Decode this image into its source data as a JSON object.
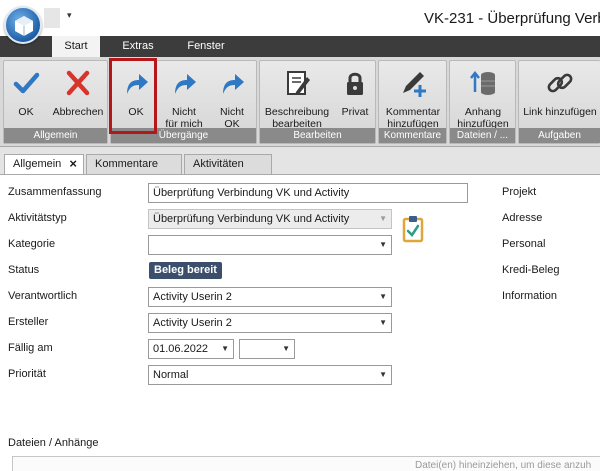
{
  "window": {
    "title": "VK-231 - Überprüfung Verbi"
  },
  "ribbon": {
    "tabs": [
      {
        "label": "Start",
        "active": true
      },
      {
        "label": "Extras",
        "active": false
      },
      {
        "label": "Fenster",
        "active": false
      }
    ],
    "groups": {
      "allgemein": "Allgemein",
      "uebergaenge": "Übergänge",
      "bearbeiten": "Bearbeiten",
      "kommentare": "Kommentare",
      "dateien": "Dateien / ...",
      "aufgaben": "Aufgaben"
    },
    "buttons": {
      "ok": "OK",
      "abbrechen": "Abbrechen",
      "transition_ok": "OK",
      "nicht_fuer_mich_1": "Nicht",
      "nicht_fuer_mich_2": "für mich",
      "nicht_ok_1": "Nicht",
      "nicht_ok_2": "OK",
      "beschreibung_1": "Beschreibung",
      "beschreibung_2": "bearbeiten",
      "privat": "Privat",
      "kommentar_1": "Kommentar",
      "kommentar_2": "hinzufügen",
      "anhang_1": "Anhang",
      "anhang_2": "hinzufügen",
      "link": "Link hinzufügen"
    }
  },
  "doc_tabs": [
    {
      "label": "Allgemein",
      "active": true
    },
    {
      "label": "Kommentare",
      "active": false
    },
    {
      "label": "Aktivitäten",
      "active": false
    }
  ],
  "form": {
    "zusammenfassung": {
      "label": "Zusammenfassung",
      "value": "Überprüfung Verbindung VK und Activity"
    },
    "aktivitaetstyp": {
      "label": "Aktivitätstyp",
      "value": "Überprüfung Verbindung VK und Activity"
    },
    "kategorie": {
      "label": "Kategorie",
      "value": ""
    },
    "status": {
      "label": "Status",
      "value": "Beleg bereit"
    },
    "verantwortlich": {
      "label": "Verantwortlich",
      "value": "Activity Userin 2"
    },
    "ersteller": {
      "label": "Ersteller",
      "value": "Activity Userin 2"
    },
    "faellig_am": {
      "label": "Fällig am",
      "date": "01.06.2022",
      "time": ""
    },
    "prioritaet": {
      "label": "Priorität",
      "value": "Normal"
    }
  },
  "right_labels": [
    "Projekt",
    "Adresse",
    "Personal",
    "Kredi-Beleg",
    "Information"
  ],
  "attachments": {
    "title": "Dateien / Anhänge",
    "hint": "Datei(en) hineinziehen, um diese anzuh"
  },
  "colors": {
    "tab_bar": "#3c3c3c",
    "group_title": "#8a8a8a",
    "accent_blue": "#2f78c4",
    "cancel_red": "#d9342b",
    "highlight_border": "#b3161b",
    "status_badge": "#3b4f6c"
  },
  "icons": {
    "ok": "checkmark-icon",
    "abbrechen": "x-icon",
    "transitions": "arrow-right-icon",
    "beschreibung": "edit-document-icon",
    "privat": "lock-icon",
    "kommentar": "pen-plus-icon",
    "anhang": "database-arrow-icon",
    "link": "chain-link-icon",
    "clipboard": "clipboard-check-icon"
  }
}
